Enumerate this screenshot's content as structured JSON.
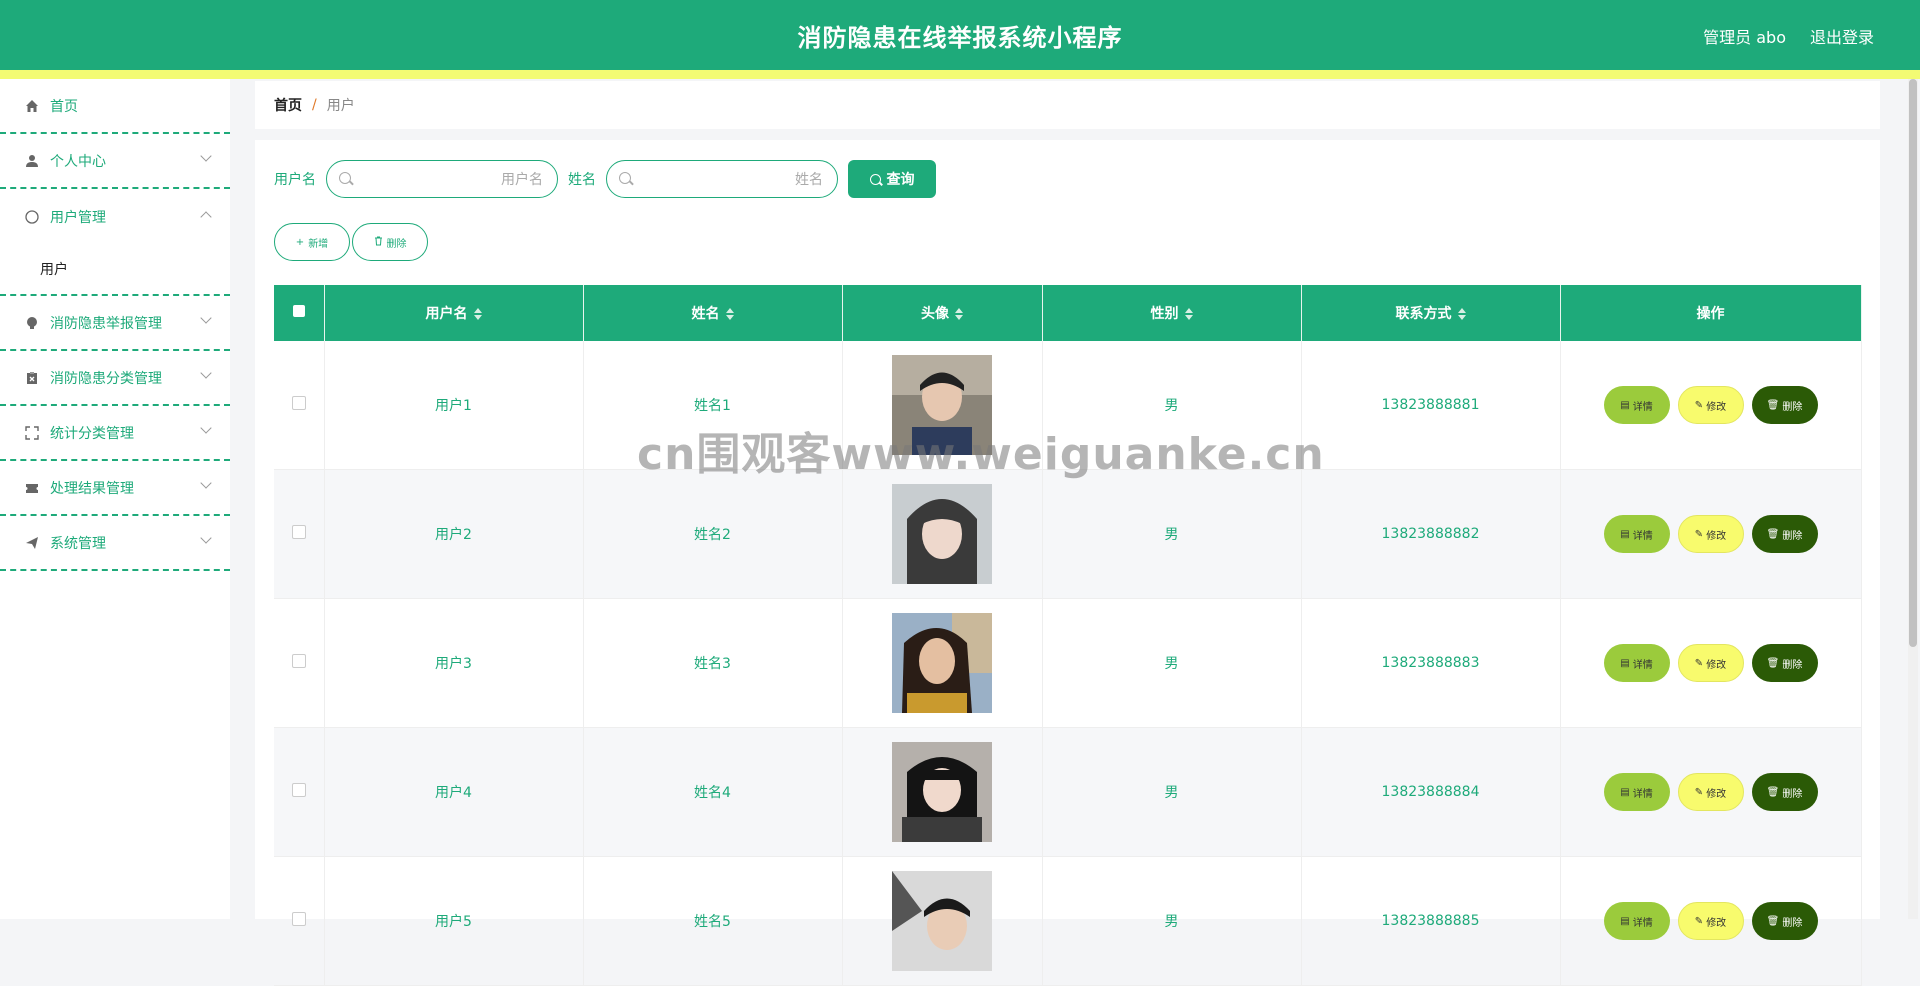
{
  "header": {
    "title": "消防隐患在线举报系统小程序",
    "admin_label": "管理员 abo",
    "logout_label": "退出登录"
  },
  "sidebar": {
    "items": [
      {
        "label": "首页",
        "icon": "home-icon"
      },
      {
        "label": "个人中心",
        "icon": "person-icon"
      },
      {
        "label": "用户管理",
        "icon": "compass-icon",
        "sub": "用户"
      },
      {
        "label": "消防隐患举报管理",
        "icon": "bulb-icon"
      },
      {
        "label": "消防隐患分类管理",
        "icon": "clipboard-x-icon"
      },
      {
        "label": "统计分类管理",
        "icon": "fullscreen-icon"
      },
      {
        "label": "处理结果管理",
        "icon": "ticket-icon"
      },
      {
        "label": "系统管理",
        "icon": "send-icon"
      }
    ]
  },
  "breadcrumb": {
    "home": "首页",
    "sep": "/",
    "current": "用户"
  },
  "search": {
    "username_label": "用户名",
    "username_placeholder": "用户名",
    "name_label": "姓名",
    "name_placeholder": "姓名",
    "query_label": "查询"
  },
  "actions": {
    "add_label": "新增",
    "delete_label": "删除"
  },
  "table": {
    "headers": [
      "用户名",
      "姓名",
      "头像",
      "性别",
      "联系方式",
      "操作"
    ],
    "rows": [
      {
        "username": "用户1",
        "name": "姓名1",
        "gender": "男",
        "phone": "13823888881"
      },
      {
        "username": "用户2",
        "name": "姓名2",
        "gender": "男",
        "phone": "13823888882"
      },
      {
        "username": "用户3",
        "name": "姓名3",
        "gender": "男",
        "phone": "13823888883"
      },
      {
        "username": "用户4",
        "name": "姓名4",
        "gender": "男",
        "phone": "13823888884"
      },
      {
        "username": "用户5",
        "name": "姓名5",
        "gender": "男",
        "phone": "13823888885"
      }
    ],
    "op_detail": "详情",
    "op_edit": "修改",
    "op_delete": "删除"
  },
  "watermark": "cn围观客www.weiguanke.cn",
  "colors": {
    "primary": "#1eaa7a",
    "accent_yellow": "#f3fb73",
    "detail": "#9bcb3c",
    "edit": "#f8fb6d",
    "delete": "#2b5a06"
  }
}
